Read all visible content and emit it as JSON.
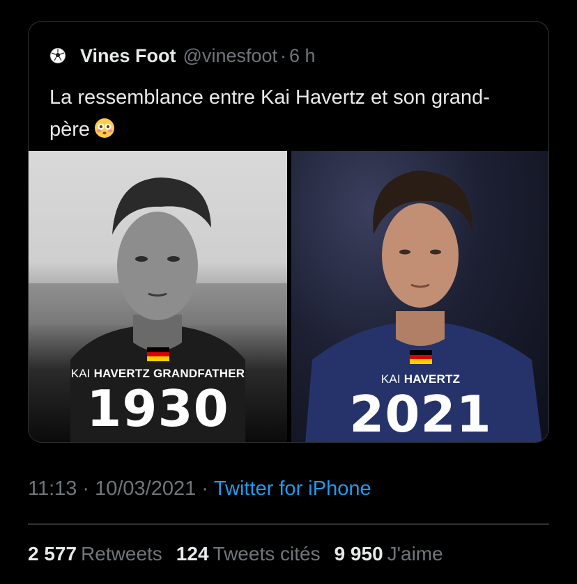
{
  "quoted_tweet": {
    "author_name": "Vines Foot",
    "author_handle": "@vinesfoot",
    "separator": "·",
    "age": "6 h",
    "text": "La ressemblance entre Kai Havertz et son grand-père",
    "emoji_icon": "flushed-face-emoji",
    "media": {
      "left": {
        "caption_prefix": "KAI ",
        "caption_bold": "HAVERTZ GRANDFATHER",
        "year": "1930"
      },
      "right": {
        "caption_prefix": "KAI ",
        "caption_bold": "HAVERTZ",
        "year": "2021"
      }
    }
  },
  "meta": {
    "time": "11:13",
    "dot1": "·",
    "date": "10/03/2021",
    "dot2": "·",
    "source": "Twitter for iPhone"
  },
  "stats": {
    "retweets_count": "2 577",
    "retweets_label": "Retweets",
    "quotes_count": "124",
    "quotes_label": "Tweets cités",
    "likes_count": "9 950",
    "likes_label": "J'aime"
  },
  "colors": {
    "background": "#000000",
    "text": "#e7e9ea",
    "muted": "#71767b",
    "link": "#1d9bf0",
    "border": "#2f3336"
  }
}
